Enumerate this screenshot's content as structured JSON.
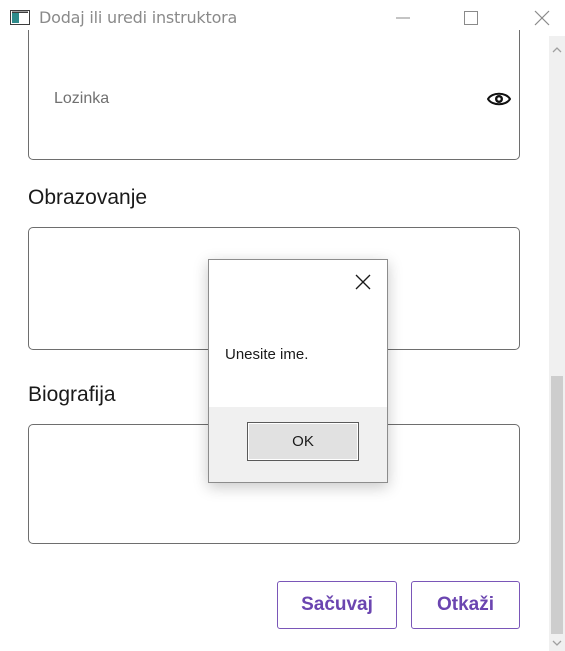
{
  "window": {
    "title": "Dodaj ili uredi instruktora",
    "icons": {
      "app": "app-window-icon",
      "minimize": "minimize-icon",
      "maximize": "maximize-icon",
      "close": "close-icon"
    }
  },
  "form": {
    "password": {
      "placeholder": "Lozinka",
      "toggle_icon": "eye-icon"
    },
    "education": {
      "label": "Obrazovanje",
      "value": ""
    },
    "biography": {
      "label": "Biografija",
      "value": ""
    },
    "buttons": {
      "save": "Sačuvaj",
      "cancel": "Otkaži"
    },
    "accent_color": "#6b45b0"
  },
  "dialog": {
    "message": "Unesite ime.",
    "ok_label": "OK",
    "close_icon": "close-icon"
  },
  "scrollbar": {
    "up_icon": "chevron-up-icon",
    "down_icon": "chevron-down-icon"
  }
}
